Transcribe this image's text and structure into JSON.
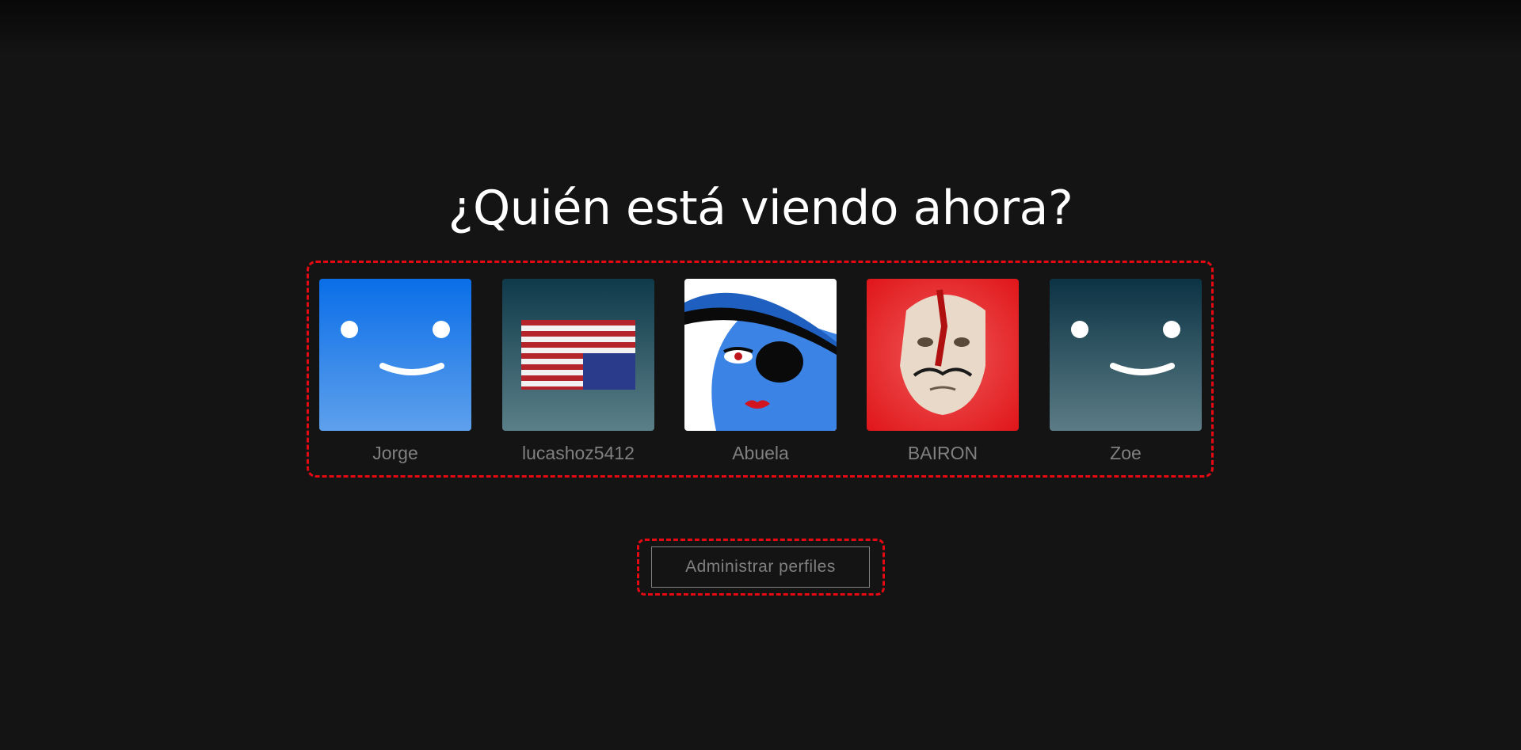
{
  "page": {
    "title": "¿Quién está viendo ahora?"
  },
  "profiles": [
    {
      "name": "Jorge",
      "avatar_icon": "smiley-blue-avatar-icon",
      "color": "#2f7ff0"
    },
    {
      "name": "lucashoz5412",
      "avatar_icon": "flag-avatar-icon",
      "color": "#2c5763"
    },
    {
      "name": "Abuela",
      "avatar_icon": "eyepatch-face-avatar-icon",
      "color": "#3f7fd8"
    },
    {
      "name": "BAIRON",
      "avatar_icon": "mask-avatar-icon",
      "color": "#e0161a"
    },
    {
      "name": "Zoe",
      "avatar_icon": "smiley-teal-avatar-icon",
      "color": "#1d4656"
    }
  ],
  "manage": {
    "label": "Administrar perfiles"
  },
  "colors": {
    "background": "#141414",
    "highlight": "#e50914",
    "muted_text": "#808080"
  }
}
